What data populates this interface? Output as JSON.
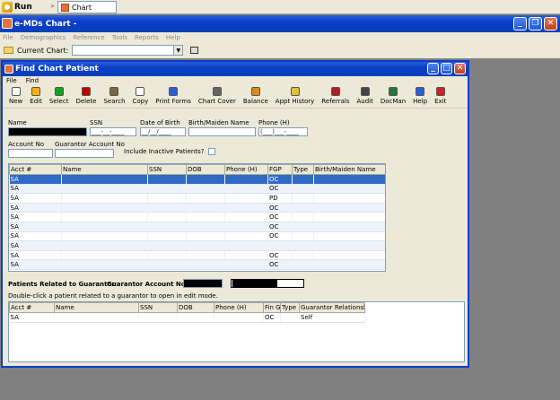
{
  "taskbar": {
    "run_label": "Run",
    "chart_tab_label": "Chart"
  },
  "app": {
    "title": "e-MDs Chart -",
    "menu": [
      "File",
      "Demographics",
      "Reference",
      "Tools",
      "Reports",
      "Help"
    ],
    "current_chart_label": "Current Chart:",
    "current_chart_value": ""
  },
  "dialog": {
    "title": "Find Chart Patient",
    "menu": [
      "File",
      "Find"
    ],
    "toolbar": [
      {
        "label": "New",
        "icon": "new-doc-icon",
        "color": "#ffffff"
      },
      {
        "label": "Edit",
        "icon": "pencil-icon",
        "color": "#f5b301"
      },
      {
        "label": "Select",
        "icon": "checkmark-icon",
        "color": "#14a01e"
      },
      {
        "label": "Delete",
        "icon": "delete-icon",
        "color": "#c00000"
      },
      {
        "label": "Search",
        "icon": "magnifier-icon",
        "color": "#7a6a3a"
      },
      {
        "label": "Copy",
        "icon": "copy-icon",
        "color": "#ffffff"
      },
      {
        "label": "Print Forms",
        "icon": "print-icon",
        "color": "#2a5ed8"
      },
      {
        "label": "Chart Cover",
        "icon": "chart-cover-icon",
        "color": "#666666"
      },
      {
        "label": "Balance",
        "icon": "balance-icon",
        "color": "#d98c1a"
      },
      {
        "label": "Appt History",
        "icon": "clock-icon",
        "color": "#e0c040"
      },
      {
        "label": "Referrals",
        "icon": "referrals-icon",
        "color": "#b02020"
      },
      {
        "label": "Audit",
        "icon": "audit-icon",
        "color": "#444444"
      },
      {
        "label": "DocMan",
        "icon": "docman-icon",
        "color": "#227744"
      },
      {
        "label": "Help",
        "icon": "help-icon",
        "color": "#2a5ed8"
      },
      {
        "label": "Exit",
        "icon": "exit-icon",
        "color": "#d02020"
      }
    ],
    "fields": {
      "name_label": "Name",
      "ssn_label": "SSN",
      "ssn_value": "___-__-____",
      "dob_label": "Date of Birth",
      "dob_value": "__/__/____",
      "birth_maiden_label": "Birth/Maiden Name",
      "phone_label": "Phone (H)",
      "phone_value": "(___)___-____",
      "account_label": "Account No",
      "guarantor_account_label": "Guarantor Account No",
      "include_inactive_label": "Include Inactive Patients?"
    },
    "results": {
      "columns": [
        "Acct #",
        "Name",
        "SSN",
        "DOB",
        "Phone (H)",
        "FGP",
        "Type",
        "Birth/Maiden Name"
      ],
      "rows": [
        [
          "SA",
          "",
          "",
          "",
          "",
          "OC",
          "",
          ""
        ],
        [
          "SA",
          "",
          "",
          "",
          "",
          "OC",
          "",
          ""
        ],
        [
          "SA",
          "",
          "",
          "",
          "",
          "PD",
          "",
          ""
        ],
        [
          "SA",
          "",
          "",
          "",
          "",
          "OC",
          "",
          ""
        ],
        [
          "SA",
          "",
          "",
          "",
          "",
          "OC",
          "",
          ""
        ],
        [
          "SA",
          "",
          "",
          "",
          "",
          "OC",
          "",
          ""
        ],
        [
          "SA",
          "",
          "",
          "",
          "",
          "OC",
          "",
          ""
        ],
        [
          "SA",
          "",
          "",
          "",
          "",
          "",
          "",
          ""
        ],
        [
          "SA",
          "",
          "",
          "",
          "",
          "OC",
          "",
          ""
        ],
        [
          "SA",
          "",
          "",
          "",
          "",
          "OC",
          "",
          ""
        ]
      ]
    },
    "guarantor": {
      "heading": "Patients Related to Guarantor.",
      "account_label": "Guarantor Account No:",
      "hint": "Double-click a patient related to a guarantor to open in edit mode.",
      "columns": [
        "Acct #",
        "Name",
        "SSN",
        "DOB",
        "Phone (H)",
        "Fin Grp",
        "Type",
        "Guarantor Relationship"
      ],
      "rows": [
        [
          "SA",
          "",
          "",
          "",
          "",
          "OC",
          "",
          "Self"
        ]
      ]
    }
  },
  "colors": {
    "title_bar": "#0a3ec7",
    "selection": "#316ac5",
    "chrome": "#ece9d8",
    "background": "#808080"
  }
}
